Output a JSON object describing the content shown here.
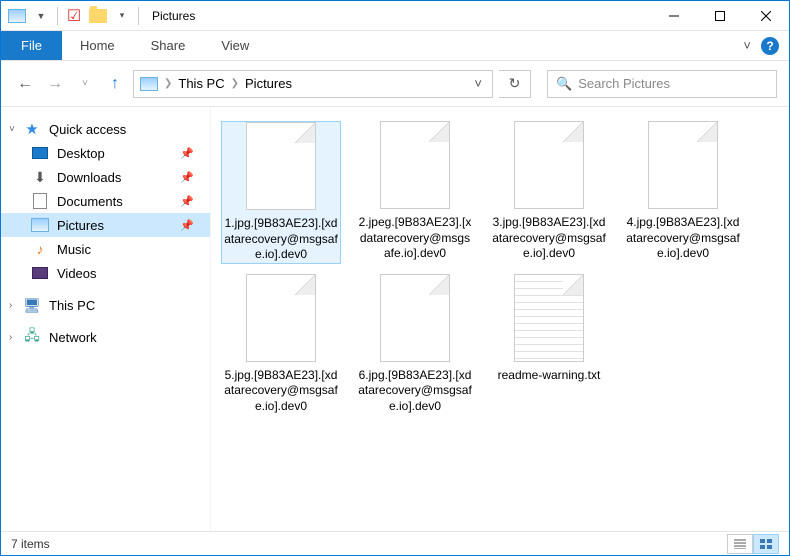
{
  "window": {
    "title": "Pictures"
  },
  "ribbon": {
    "file": "File",
    "tabs": [
      "Home",
      "Share",
      "View"
    ],
    "expand": "˅"
  },
  "nav": {
    "breadcrumb": [
      "This PC",
      "Pictures"
    ],
    "search_placeholder": "Search Pictures"
  },
  "sidebar": {
    "quick_access": "Quick access",
    "items": [
      {
        "label": "Desktop",
        "icon": "desktop"
      },
      {
        "label": "Downloads",
        "icon": "downloads"
      },
      {
        "label": "Documents",
        "icon": "documents"
      },
      {
        "label": "Pictures",
        "icon": "pictures",
        "selected": true
      },
      {
        "label": "Music",
        "icon": "music"
      },
      {
        "label": "Videos",
        "icon": "videos"
      }
    ],
    "this_pc": "This PC",
    "network": "Network"
  },
  "files": [
    {
      "name": "1.jpg.[9B83AE23].[xdatarecovery@msgsafe.io].dev0",
      "type": "file",
      "selected": true
    },
    {
      "name": "2.jpeg.[9B83AE23].[xdatarecovery@msgsafe.io].dev0",
      "type": "file"
    },
    {
      "name": "3.jpg.[9B83AE23].[xdatarecovery@msgsafe.io].dev0",
      "type": "file"
    },
    {
      "name": "4.jpg.[9B83AE23].[xdatarecovery@msgsafe.io].dev0",
      "type": "file"
    },
    {
      "name": "5.jpg.[9B83AE23].[xdatarecovery@msgsafe.io].dev0",
      "type": "file"
    },
    {
      "name": "6.jpg.[9B83AE23].[xdatarecovery@msgsafe.io].dev0",
      "type": "file"
    },
    {
      "name": "readme-warning.txt",
      "type": "txt"
    }
  ],
  "status": {
    "count": "7 items"
  }
}
